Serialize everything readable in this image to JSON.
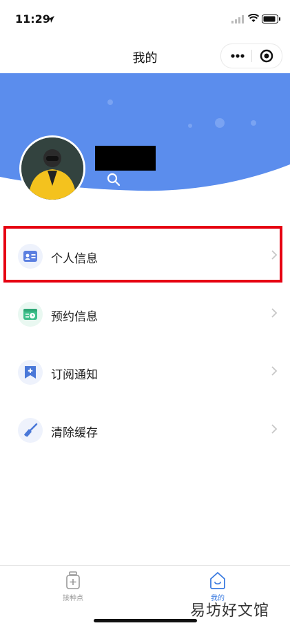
{
  "status": {
    "time": "11:29"
  },
  "nav": {
    "title": "我的"
  },
  "menu": [
    {
      "label": "个人信息",
      "icon": "id-card-icon",
      "color": "#5b7fe0",
      "bg": "#eef2fc"
    },
    {
      "label": "预约信息",
      "icon": "calendar-clock-icon",
      "color": "#3dbf8a",
      "bg": "#e9f8f1"
    },
    {
      "label": "订阅通知",
      "icon": "bookmark-plus-icon",
      "color": "#4a78d8",
      "bg": "#eef2fc"
    },
    {
      "label": "清除缓存",
      "icon": "broom-icon",
      "color": "#4a78d8",
      "bg": "#eef2fc"
    }
  ],
  "tabs": [
    {
      "label": "接种点",
      "icon": "vaccine-bottle-icon",
      "active": false
    },
    {
      "label": "我的",
      "icon": "home-smile-icon",
      "active": true
    }
  ],
  "colors": {
    "header_blue": "#5b8ded",
    "highlight_red": "#e60012",
    "tab_active": "#3b7be0",
    "tab_inactive": "#999999"
  },
  "watermark": "易坊好文馆"
}
